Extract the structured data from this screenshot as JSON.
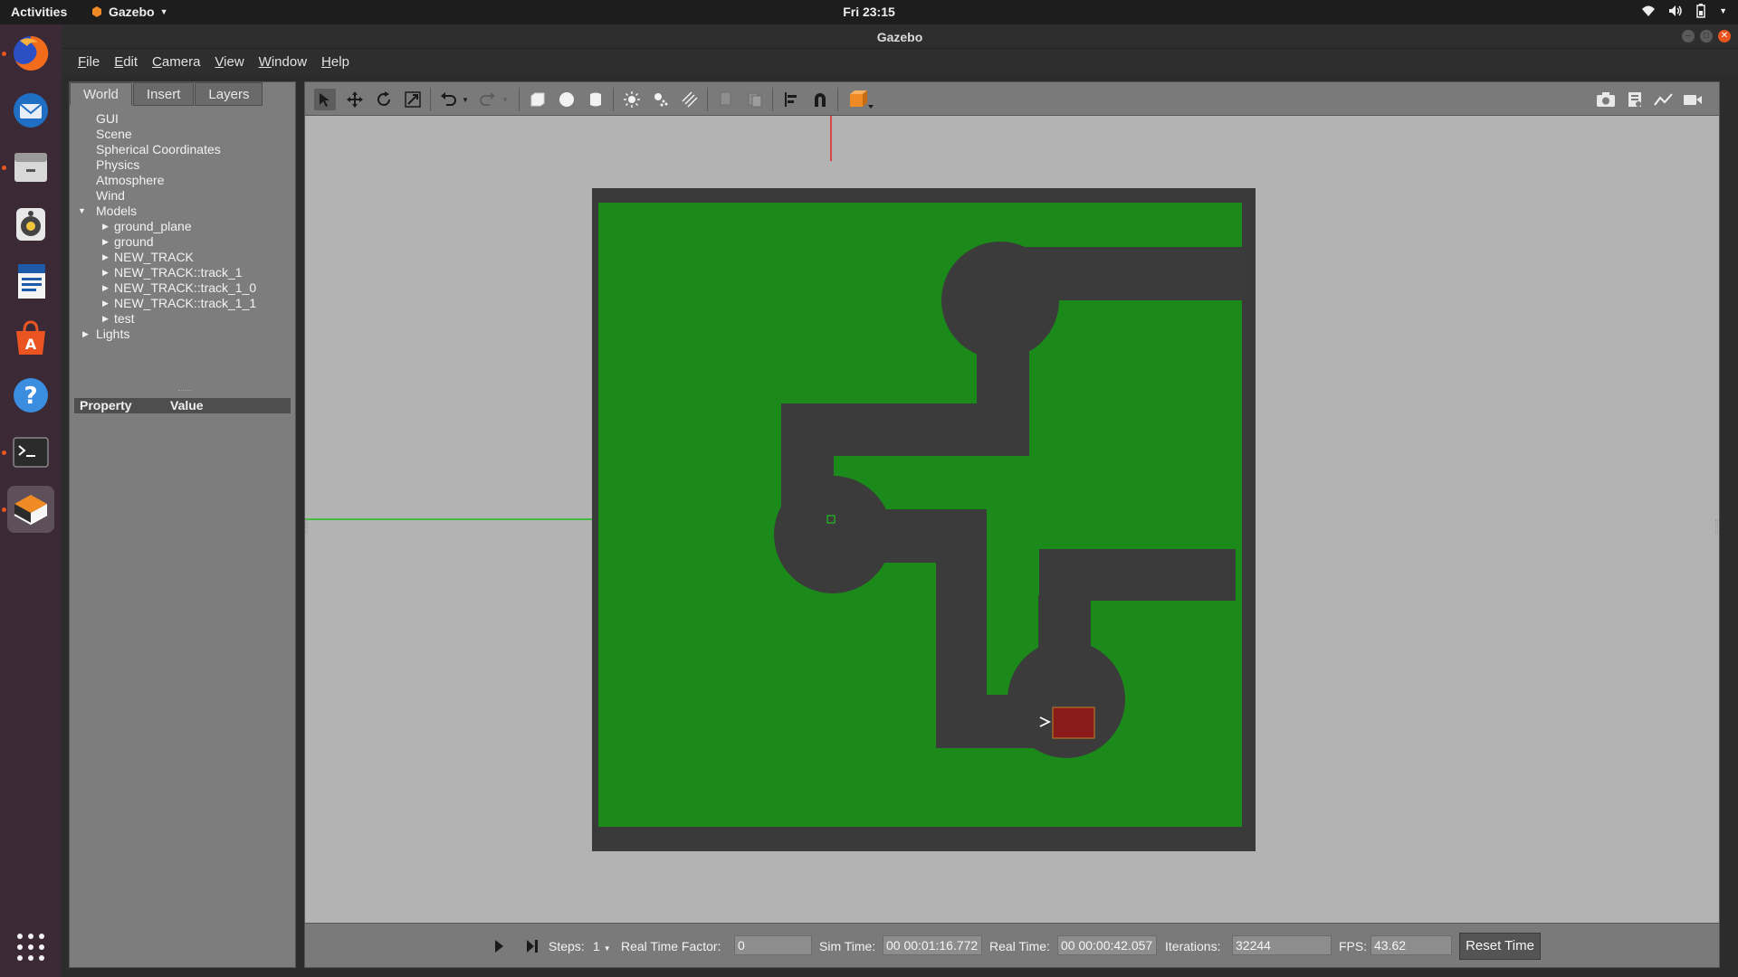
{
  "topbar": {
    "activities": "Activities",
    "app_name": "Gazebo",
    "clock": "Fri 23:15"
  },
  "window": {
    "title": "Gazebo"
  },
  "menubar": {
    "items": [
      {
        "label": "File",
        "mn": "F",
        "rest": "ile"
      },
      {
        "label": "Edit",
        "mn": "E",
        "rest": "dit"
      },
      {
        "label": "Camera",
        "mn": "C",
        "rest": "amera"
      },
      {
        "label": "View",
        "mn": "V",
        "rest": "iew"
      },
      {
        "label": "Window",
        "mn": "W",
        "rest": "indow"
      },
      {
        "label": "Help",
        "mn": "H",
        "rest": "elp"
      }
    ]
  },
  "dock": {
    "apps": [
      "firefox",
      "thunderbird",
      "files",
      "rhythmbox",
      "libreoffice-writer",
      "ubuntu-software",
      "help",
      "terminal",
      "gazebo"
    ]
  },
  "left_panel": {
    "tabs": [
      "World",
      "Insert",
      "Layers"
    ],
    "tree": {
      "gui": "GUI",
      "scene": "Scene",
      "spherical": "Spherical Coordinates",
      "physics": "Physics",
      "atmosphere": "Atmosphere",
      "wind": "Wind",
      "models": "Models",
      "model_items": [
        "ground_plane",
        "ground",
        "NEW_TRACK",
        "NEW_TRACK::track_1",
        "NEW_TRACK::track_1_0",
        "NEW_TRACK::track_1_1",
        "test"
      ],
      "lights": "Lights"
    },
    "props": {
      "property": "Property",
      "value": "Value"
    }
  },
  "bottombar": {
    "steps_label": "Steps:",
    "steps_value": "1",
    "rtf_label": "Real Time Factor:",
    "rtf_value": "0",
    "sim_label": "Sim Time:",
    "sim_value": "00 00:01:16.772",
    "real_label": "Real Time:",
    "real_value": "00 00:00:42.057",
    "iter_label": "Iterations:",
    "iter_value": "32244",
    "fps_label": "FPS:",
    "fps_value": "43.62",
    "reset_label": "Reset Time"
  },
  "scene": {
    "ground_color": "#1b8a1b",
    "border_color": "#3a3a3a",
    "track_color": "#3b3b3b",
    "robot_color": "#8b1a1a",
    "x_axis_color": "#e02020",
    "y_axis_color": "#20c020"
  }
}
